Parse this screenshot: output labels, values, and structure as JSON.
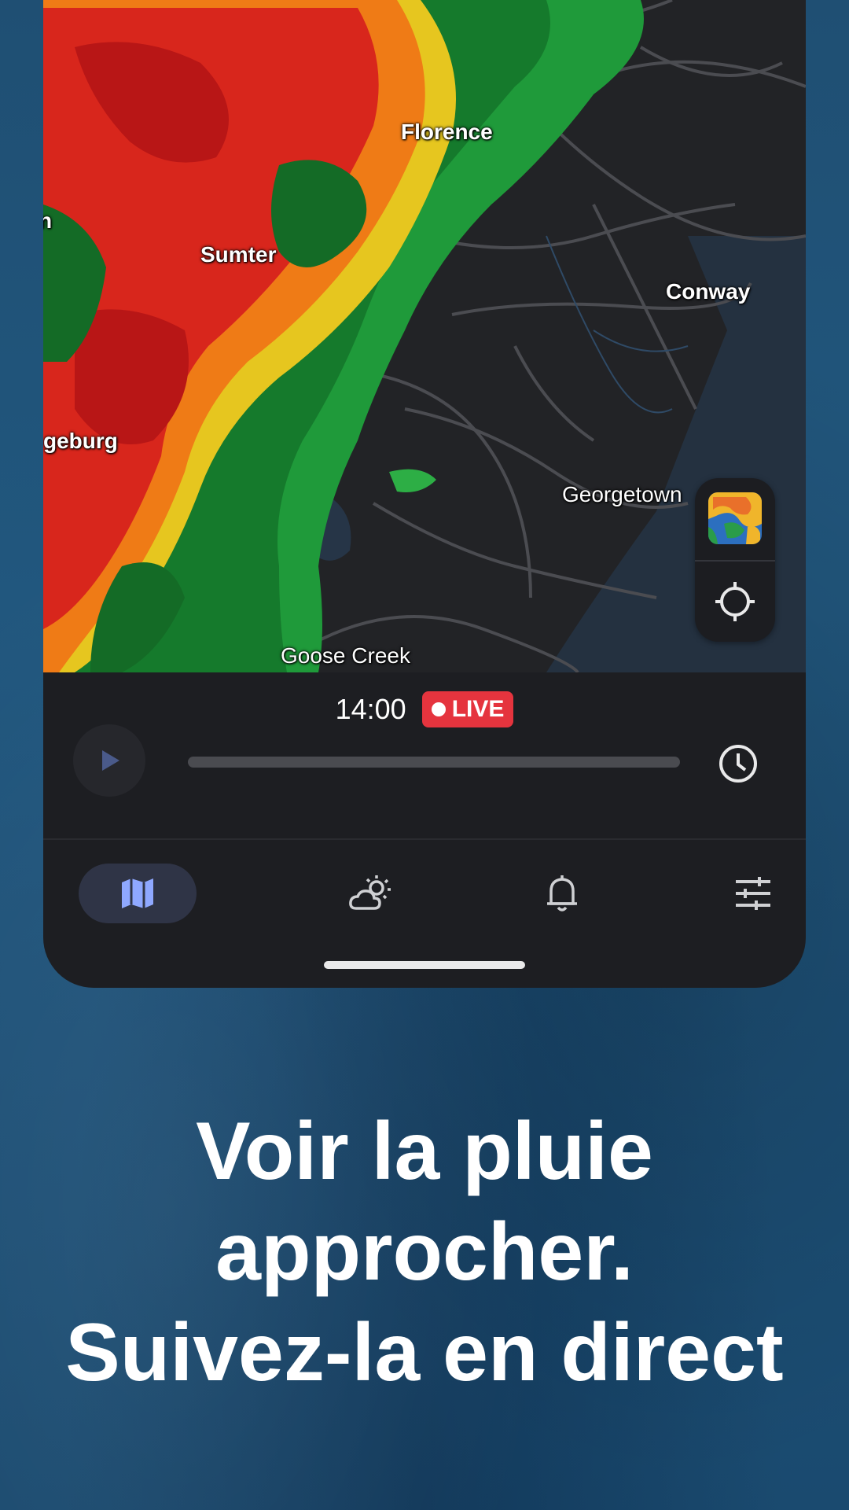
{
  "map": {
    "cities": {
      "florence": "Florence",
      "sumter": "Sumter",
      "conway": "Conway",
      "orangeburg": "geburg",
      "georgetown": "Georgetown",
      "goose_creek": "Goose Creek",
      "edge": "n"
    },
    "controls": {
      "layer_icon": "radar-layer-icon",
      "locate_icon": "crosshair-locate-icon"
    }
  },
  "timeline": {
    "time": "14:00",
    "live_label": "LIVE",
    "live_color": "#e5343e",
    "progress": 1.0,
    "play_icon": "play-icon",
    "history_icon": "clock-icon"
  },
  "nav": {
    "items": [
      {
        "icon": "map-icon",
        "active": true
      },
      {
        "icon": "partly-cloudy-icon",
        "active": false
      },
      {
        "icon": "bell-icon",
        "active": false
      },
      {
        "icon": "sliders-icon",
        "active": false
      }
    ],
    "active_color": "#8fa8ff"
  },
  "headline": {
    "line1": "Voir la pluie",
    "line2": "approcher.",
    "line3": "Suivez-la en direct"
  }
}
